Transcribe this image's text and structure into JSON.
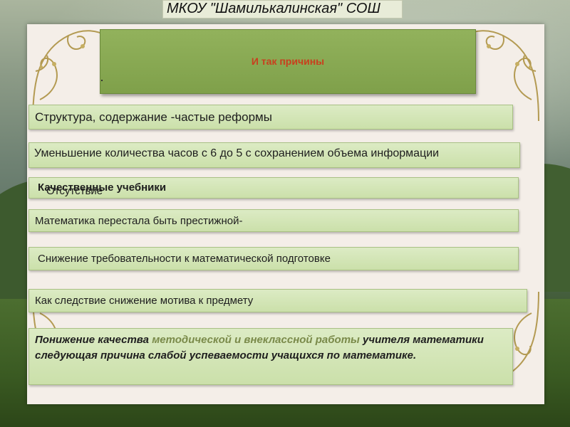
{
  "school": {
    "name": "МКОУ \"Шамилькалинская\" СОШ"
  },
  "slide": {
    "title": "И так причины",
    "items": [
      {
        "text": "Структура, содержание -частые реформы"
      },
      {
        "text": "Уменьшение количества часов с 6 до 5 с сохранением объема информации"
      },
      {
        "prefix": "Отсутствие ",
        "bold": "Качественные учебники"
      },
      {
        "text": "Математика перестала быть престижной-"
      },
      {
        "text": "Снижение требовательности к математической подготовке"
      },
      {
        "text": "Как следствие снижение мотива к предмету"
      },
      {
        "part1": "Понижение качества ",
        "part2": "методической и внеклассной работы",
        "part3": " учителя математики следующая причина слабой успеваемости учащихся по математике."
      }
    ]
  },
  "colors": {
    "title_box": "#86a650",
    "title_text": "#c8401e",
    "bar_fill": "#d3e6b5",
    "frame": "#f4eee8",
    "ornament": "#b39a52"
  }
}
